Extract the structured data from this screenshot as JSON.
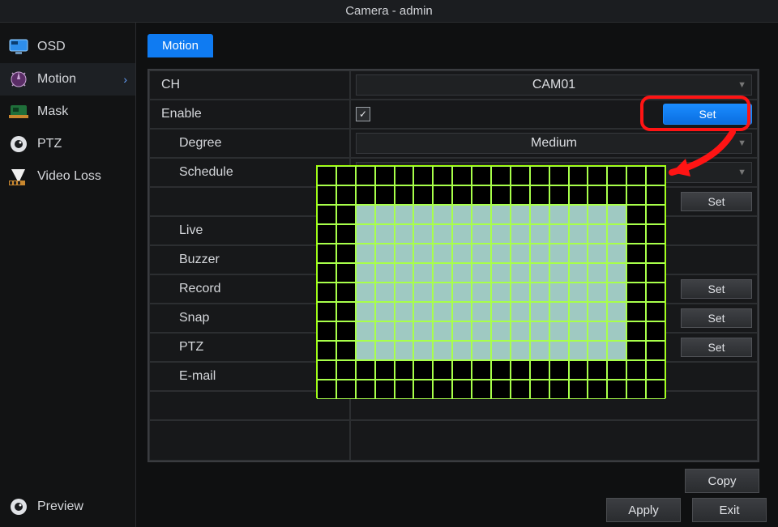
{
  "window": {
    "title": "Camera - admin"
  },
  "sidebar": {
    "items": [
      {
        "label": "OSD"
      },
      {
        "label": "Motion"
      },
      {
        "label": "Mask"
      },
      {
        "label": "PTZ"
      },
      {
        "label": "Video Loss"
      }
    ],
    "preview": "Preview"
  },
  "tabs": {
    "motion": "Motion"
  },
  "fields": {
    "ch": {
      "label": "CH",
      "value": "CAM01"
    },
    "enable": {
      "label": "Enable",
      "checked": true,
      "set": "Set"
    },
    "degree": {
      "label": "Degree",
      "value": "Medium"
    },
    "schedule": {
      "label": "Schedule",
      "set": "Set"
    },
    "live": {
      "label": "Live"
    },
    "buzzer": {
      "label": "Buzzer"
    },
    "record": {
      "label": "Record",
      "set": "Set"
    },
    "snap": {
      "label": "Snap",
      "set": "Set"
    },
    "ptz": {
      "label": "PTZ",
      "set": "Set"
    },
    "email": {
      "label": "E-mail"
    }
  },
  "buttons": {
    "copy": "Copy",
    "apply": "Apply",
    "exit": "Exit"
  },
  "motion_grid": {
    "cols": 18,
    "rows": 12,
    "margin_off_top": 2,
    "margin_off_bottom": 2,
    "margin_off_left": 2,
    "margin_off_right": 2
  }
}
